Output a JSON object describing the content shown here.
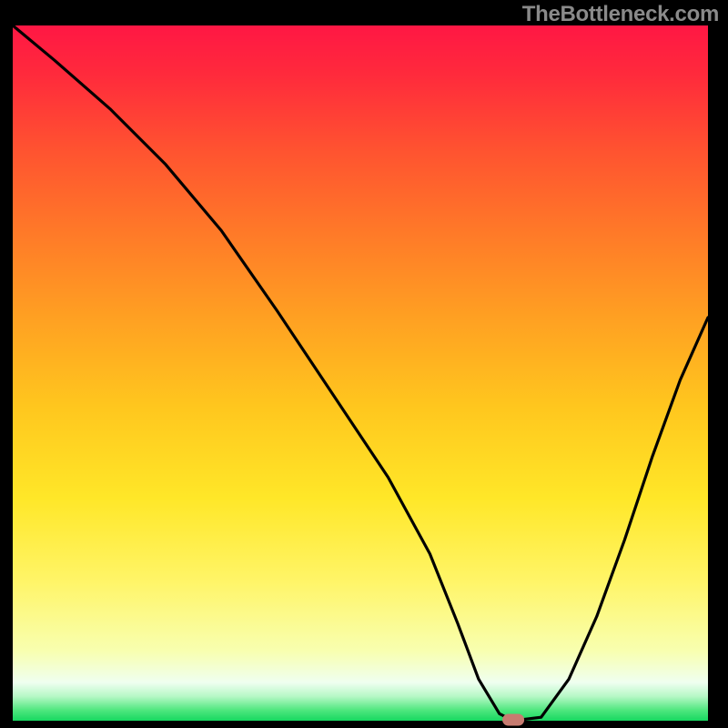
{
  "watermark": "TheBottleneck.com",
  "chart_data": {
    "type": "line",
    "title": "",
    "xlabel": "",
    "ylabel": "",
    "xlim": [
      0,
      100
    ],
    "ylim": [
      0,
      100
    ],
    "x": [
      0,
      6,
      14,
      22,
      30,
      38,
      46,
      54,
      60,
      64,
      67,
      70,
      72,
      76,
      80,
      84,
      88,
      92,
      96,
      100
    ],
    "values": [
      100,
      95,
      88,
      80,
      70.5,
      59,
      47,
      35,
      24,
      14,
      6,
      1,
      0,
      0.5,
      6,
      15,
      26,
      38,
      49,
      58
    ],
    "marker": {
      "x": 72,
      "y": 0
    },
    "gradient_stops": [
      {
        "offset": 0.0,
        "color": "#ff1744"
      },
      {
        "offset": 0.07,
        "color": "#ff2a3c"
      },
      {
        "offset": 0.18,
        "color": "#ff5330"
      },
      {
        "offset": 0.3,
        "color": "#ff7a28"
      },
      {
        "offset": 0.42,
        "color": "#ffa022"
      },
      {
        "offset": 0.55,
        "color": "#ffc71e"
      },
      {
        "offset": 0.68,
        "color": "#ffe728"
      },
      {
        "offset": 0.8,
        "color": "#fff568"
      },
      {
        "offset": 0.9,
        "color": "#f8ffb0"
      },
      {
        "offset": 0.945,
        "color": "#effff0"
      },
      {
        "offset": 0.965,
        "color": "#b6f8c6"
      },
      {
        "offset": 0.985,
        "color": "#4ee77e"
      },
      {
        "offset": 1.0,
        "color": "#17d860"
      }
    ],
    "marker_color": "#c77b70",
    "line_color": "#000000"
  },
  "layout": {
    "outer": 800,
    "inner": 764,
    "margin_left": 14,
    "margin_top": 28,
    "margin_right": 22,
    "margin_bottom": 8
  }
}
